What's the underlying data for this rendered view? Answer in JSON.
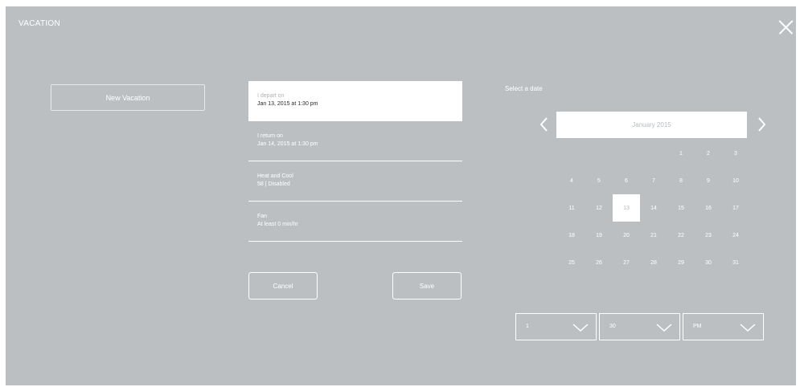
{
  "header": {
    "title": "VACATION"
  },
  "left": {
    "new_vacation_label": "New Vacation"
  },
  "settings": [
    {
      "label": "I depart on",
      "value": "Jan 13, 2015 at 1:30 pm",
      "selected": true
    },
    {
      "label": "I return on",
      "value": "Jan 14, 2015 at 1:30 pm",
      "selected": false
    },
    {
      "label": "Heat and Cool",
      "value": "58 | Disabled",
      "selected": false
    },
    {
      "label": "Fan",
      "value": "At least 0 min/hr",
      "selected": false
    }
  ],
  "actions": {
    "cancel_label": "Cancel",
    "save_label": "Save"
  },
  "calendar": {
    "prompt": "Select a date",
    "month_label": "January 2015",
    "first_weekday_index": 4,
    "days_in_month": 31,
    "selected_day": 13,
    "days": [
      "1",
      "2",
      "3",
      "4",
      "5",
      "6",
      "7",
      "8",
      "9",
      "10",
      "11",
      "12",
      "13",
      "14",
      "15",
      "16",
      "17",
      "18",
      "19",
      "20",
      "21",
      "22",
      "23",
      "24",
      "25",
      "26",
      "27",
      "28",
      "29",
      "30",
      "31"
    ]
  },
  "time": {
    "hour": "1",
    "minute": "30",
    "period": "PM"
  },
  "icons": {
    "close": "close-icon",
    "prev": "chevron-left-icon",
    "next": "chevron-right-icon",
    "dropdown": "chevron-down-icon"
  },
  "colors": {
    "panel": "#bcbfc2",
    "text": "#ffffff",
    "selected_bg": "#ffffff"
  }
}
